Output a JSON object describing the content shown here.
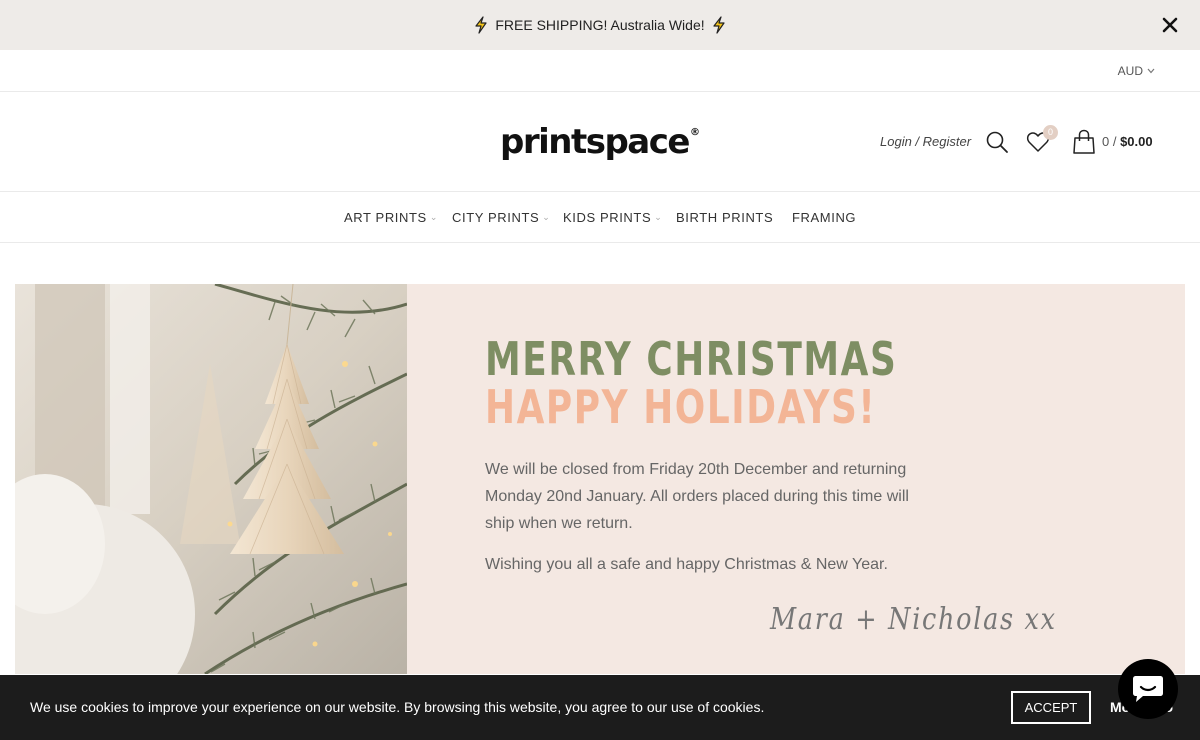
{
  "announcement": {
    "text": "FREE SHIPPING! Australia Wide!"
  },
  "topbar": {
    "currency": "AUD"
  },
  "header": {
    "logo": "printspace",
    "logo_mark": "®",
    "login": "Login / Register",
    "wishlist_count": "0",
    "cart_count": "0 / ",
    "cart_total": "$0.00"
  },
  "nav": {
    "items": [
      {
        "label": "ART PRINTS",
        "dropdown": true
      },
      {
        "label": "CITY PRINTS",
        "dropdown": true
      },
      {
        "label": "KIDS PRINTS",
        "dropdown": true
      },
      {
        "label": "BIRTH PRINTS",
        "dropdown": false
      },
      {
        "label": "FRAMING",
        "dropdown": false
      }
    ]
  },
  "banner": {
    "headline_1": "MERRY CHRISTMAS",
    "headline_2": "HAPPY HOLIDAYS!",
    "closed_notice": "We will be closed from Friday 20th December and returning Monday 20nd January. All orders placed during this time will ship when we return.",
    "wishes": "Wishing you all a safe and happy Christmas & New Year.",
    "signature": "Mara + Nicholas xx"
  },
  "cookie": {
    "text": "We use cookies to improve your experience on our website. By browsing this website, you agree to our use of cookies.",
    "accept": "ACCEPT",
    "more": "More info"
  },
  "colors": {
    "announcement_bg": "#eeebe8",
    "banner_bg": "#f4e8e2",
    "headline_green": "#7e8e63",
    "headline_peach": "#f3b596",
    "cookie_bg": "#1c1c1c",
    "bolt": "#f5c518"
  }
}
